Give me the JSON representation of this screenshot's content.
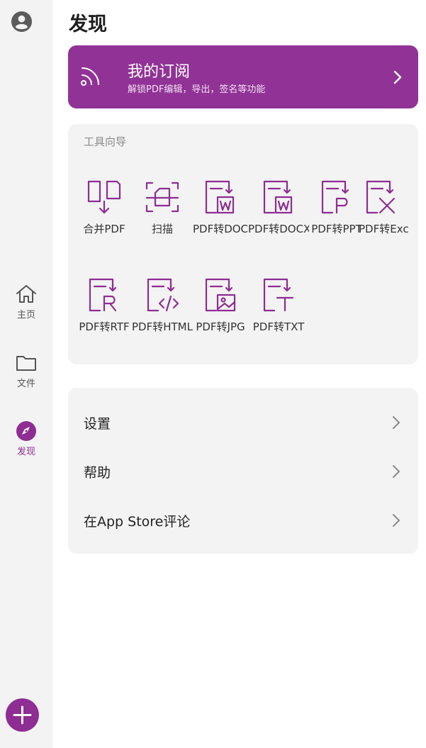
{
  "page": {
    "title": "发现"
  },
  "nav": {
    "home_label": "主页",
    "files_label": "文件",
    "discover_label": "发现"
  },
  "subscription": {
    "title": "我的订阅",
    "description": "解锁PDF编辑，导出，签名等功能"
  },
  "tools": {
    "header": "工具向导",
    "items": [
      {
        "label": "合并PDF",
        "icon": "merge-pdf-icon"
      },
      {
        "label": "扫描",
        "icon": "scan-icon"
      },
      {
        "label": "PDF转DOC",
        "icon": "pdf-to-doc-icon"
      },
      {
        "label": "PDF转DOCX",
        "icon": "pdf-to-docx-icon"
      },
      {
        "label": "PDF转PPT",
        "icon": "pdf-to-ppt-icon"
      },
      {
        "label": "PDF转Exc",
        "icon": "pdf-to-excel-icon"
      },
      {
        "label": "PDF转RTF",
        "icon": "pdf-to-rtf-icon"
      },
      {
        "label": "PDF转HTML",
        "icon": "pdf-to-html-icon"
      },
      {
        "label": "PDF转JPG",
        "icon": "pdf-to-jpg-icon"
      },
      {
        "label": "PDF转TXT",
        "icon": "pdf-to-txt-icon"
      }
    ]
  },
  "menu": {
    "items": [
      {
        "label": "设置"
      },
      {
        "label": "帮助"
      },
      {
        "label": "在App Store评论"
      }
    ]
  },
  "colors": {
    "accent": "#8e2d93",
    "card_bg": "#f3f3f3",
    "rail_bg": "#f3f3f3"
  }
}
